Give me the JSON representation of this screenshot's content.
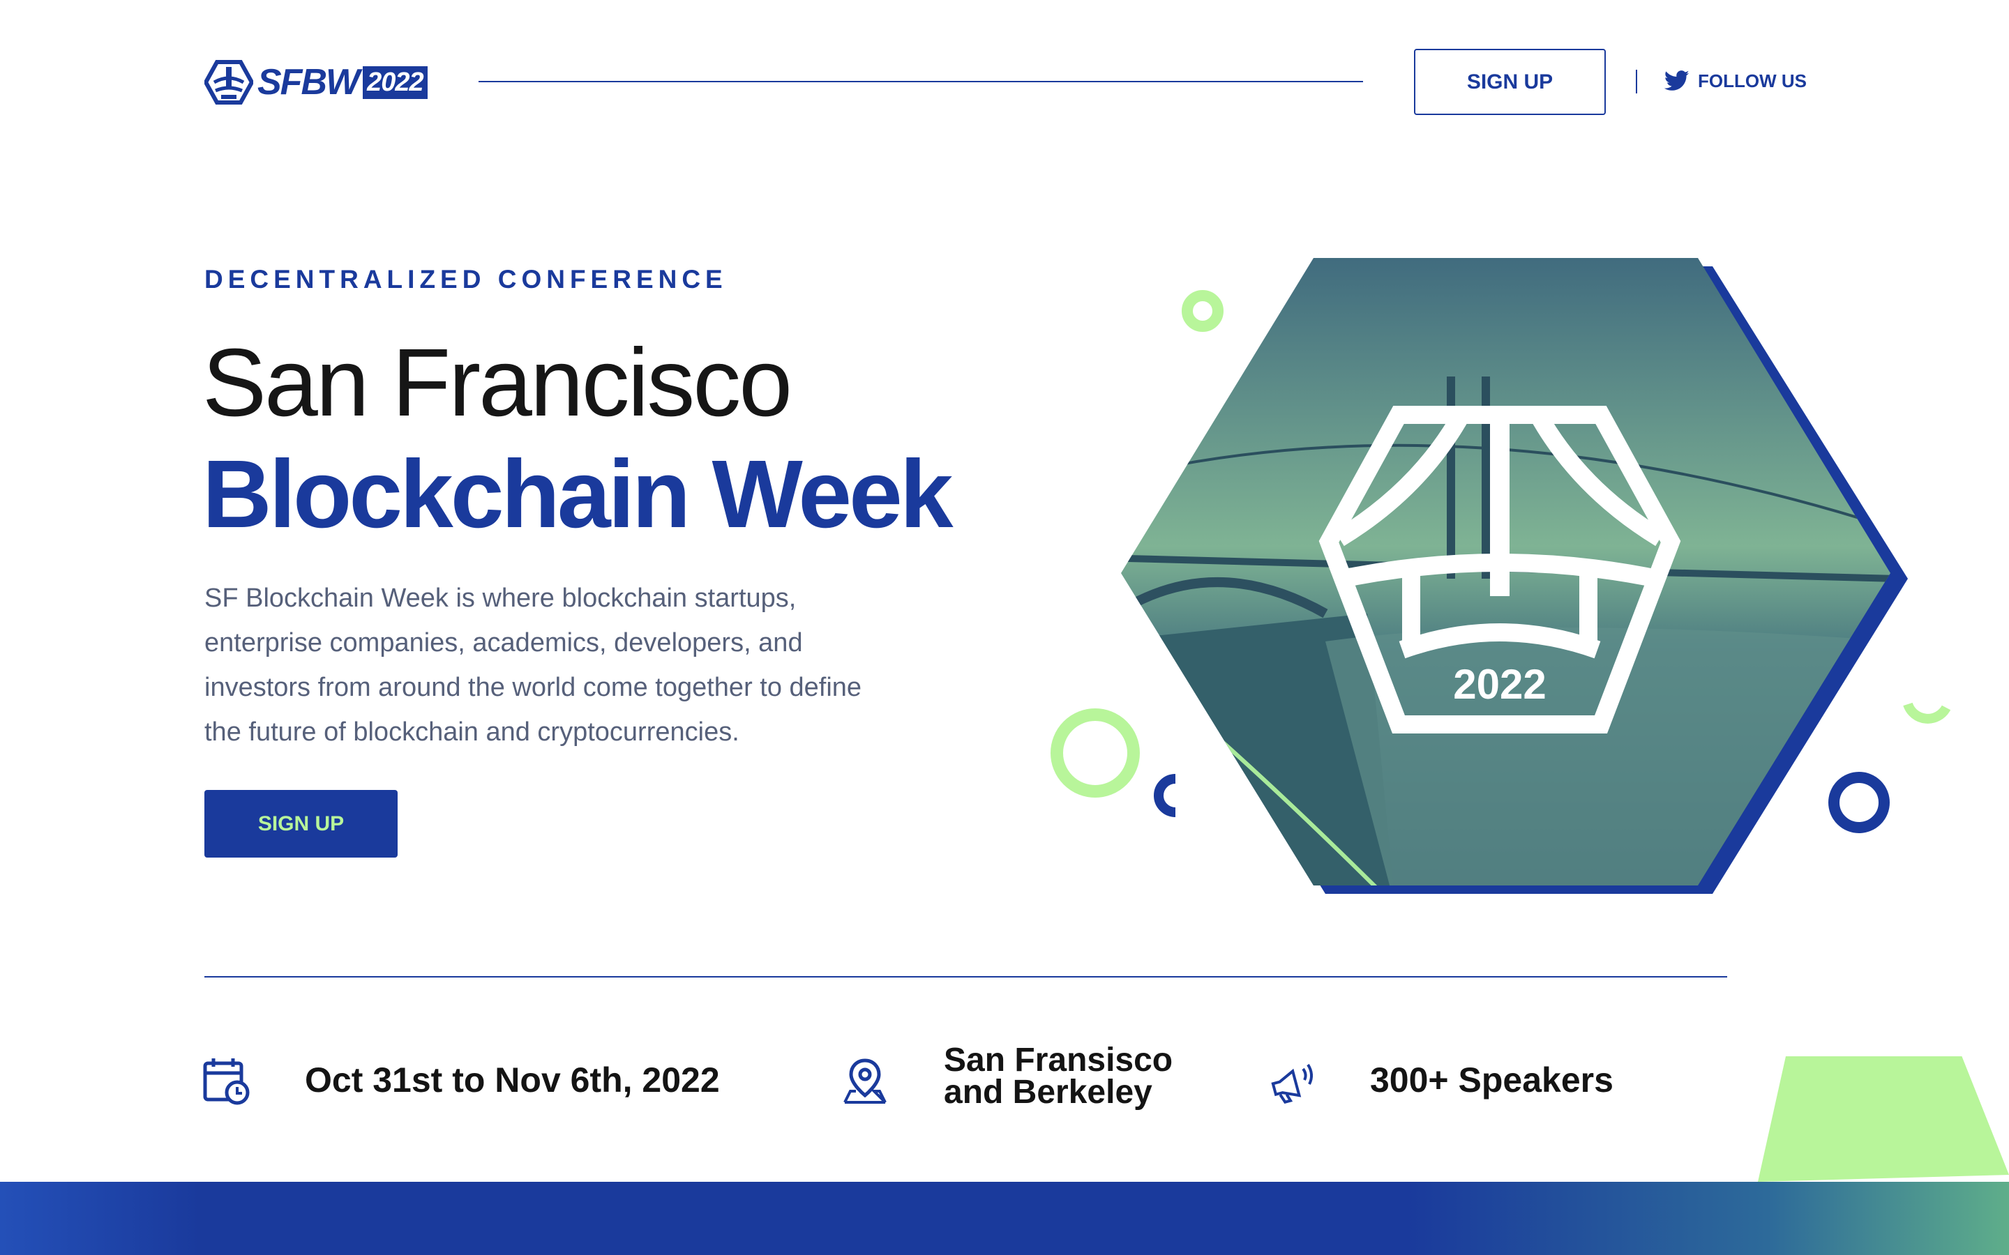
{
  "header": {
    "logo_text": "SFBW",
    "logo_year": "2022",
    "signup_label": "SIGN UP",
    "follow_label": "FOLLOW US"
  },
  "hero": {
    "eyebrow": "DECENTRALIZED CONFERENCE",
    "title_line1": "San Francisco",
    "title_line2": "Blockchain Week",
    "description": "SF Blockchain Week is where blockchain startups, enterprise companies, academics, developers, and investors from around the world come together to define the future of blockchain and cryptocurrencies.",
    "signup_label": "SIGN UP",
    "badge_year": "2022"
  },
  "info": {
    "date": "Oct 31st to Nov 6th, 2022",
    "location_line1": "San Fransisco",
    "location_line2": "and Berkeley",
    "speakers": "300+ Speakers"
  },
  "colors": {
    "brand_blue": "#1a3a9c",
    "accent_green": "#b8f59a",
    "text_dark": "#141414",
    "text_muted": "#56607a"
  },
  "icons": {
    "logo": "bridge-hexagon-logo",
    "twitter": "twitter-icon",
    "calendar": "calendar-clock-icon",
    "location": "map-pin-icon",
    "speakers": "megaphone-icon"
  }
}
